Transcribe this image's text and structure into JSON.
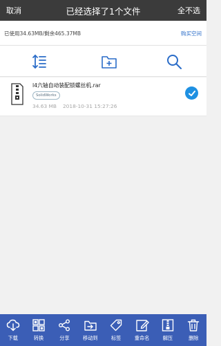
{
  "titlebar": {
    "cancel_label": "取消",
    "title": "已经选择了1个文件",
    "deselect_label": "全不选"
  },
  "storage": {
    "usage_text": "已使用34.63MB/剩余465.37MB",
    "buy_label": "购买空间"
  },
  "toolbar": {
    "icons": [
      "sort-icon",
      "new-folder-icon",
      "search-icon"
    ]
  },
  "files": [
    {
      "name": "l4六轴自动装配锁螺丝机.rar",
      "tag": "SolidWorks",
      "size": "34.63 MB",
      "date": "2018-10-31 15:27:26",
      "selected": true
    }
  ],
  "bottom_actions": [
    {
      "label": "下载",
      "icon": "cloud-download-icon"
    },
    {
      "label": "转换",
      "icon": "convert-icon"
    },
    {
      "label": "分享",
      "icon": "share-icon"
    },
    {
      "label": "移动到",
      "icon": "move-to-folder-icon"
    },
    {
      "label": "标签",
      "icon": "tag-icon"
    },
    {
      "label": "重命名",
      "icon": "rename-icon"
    },
    {
      "label": "解压",
      "icon": "extract-icon"
    },
    {
      "label": "删除",
      "icon": "trash-icon"
    }
  ],
  "colors": {
    "titlebar_bg": "#3b3b3b",
    "bottombar_bg": "#3b5eb6",
    "accent": "#1e90e2",
    "link": "#2a6cc8"
  }
}
